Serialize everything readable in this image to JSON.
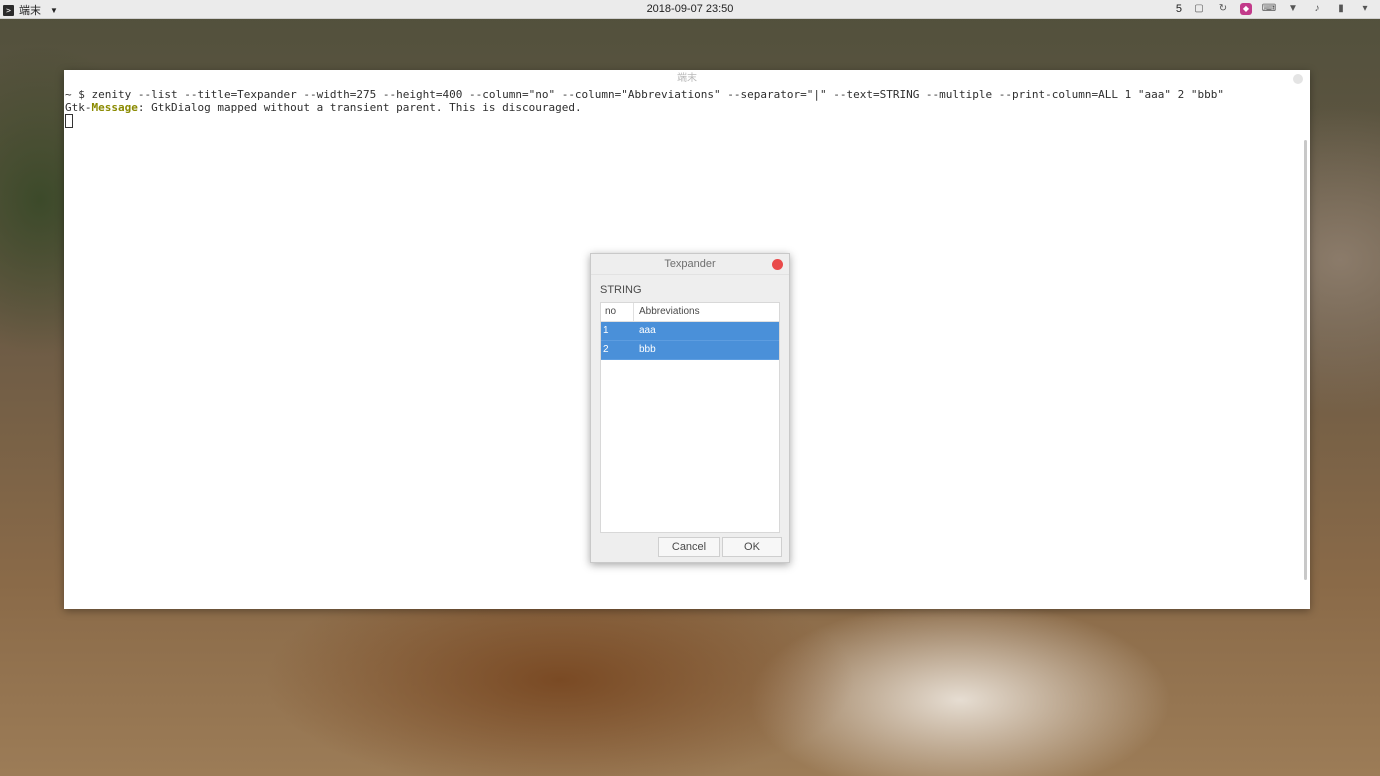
{
  "panel": {
    "app_label": "端末",
    "clock": "2018-09-07 23:50",
    "workspace": "5"
  },
  "terminal": {
    "title": "端末",
    "line1": "~ $ zenity --list --title=Texpander --width=275 --height=400 --column=\"no\" --column=\"Abbreviations\" --separator=\"|\" --text=STRING --multiple --print-column=ALL 1 \"aaa\" 2 \"bbb\"",
    "line2_prefix": "Gtk-",
    "line2_highlight": "Message",
    "line2_rest": ": GtkDialog mapped without a transient parent. This is discouraged."
  },
  "dialog": {
    "title": "Texpander",
    "text": "STRING",
    "columns": [
      "no",
      "Abbreviations"
    ],
    "rows": [
      {
        "no": "1",
        "abbr": "aaa",
        "selected": true
      },
      {
        "no": "2",
        "abbr": "bbb",
        "selected": true
      }
    ],
    "cancel_label": "Cancel",
    "ok_label": "OK"
  },
  "colors": {
    "selection": "#4a90d9",
    "close_button": "#e94a4a",
    "gtk_message": "#8a8a00"
  }
}
